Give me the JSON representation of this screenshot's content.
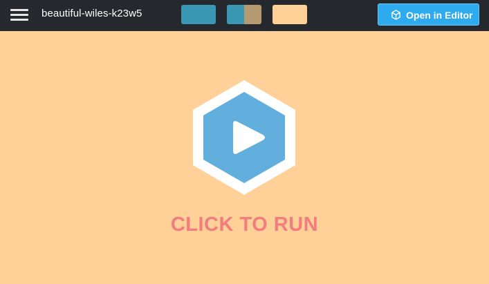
{
  "header": {
    "sandbox_name": "beautiful-wiles-k23w5",
    "menu_icon": "hamburger-menu-icon",
    "layout_buttons": [
      {
        "name": "editor-view",
        "color": "#3A98B5"
      },
      {
        "name": "split-view",
        "colors": [
          "#3A98B5",
          "#B69B72"
        ]
      },
      {
        "name": "preview-view",
        "color": "#FFD097"
      }
    ],
    "open_editor": {
      "label": "Open in Editor",
      "icon": "cube-icon",
      "color": "#2EAAEE"
    },
    "background": "#25282D"
  },
  "preview": {
    "background": "#FFD097",
    "play_icon": "play-hexagon-icon",
    "play_color": "#62AFDD",
    "run_label": "CLICK TO RUN",
    "run_label_color": "#F27C7E"
  }
}
